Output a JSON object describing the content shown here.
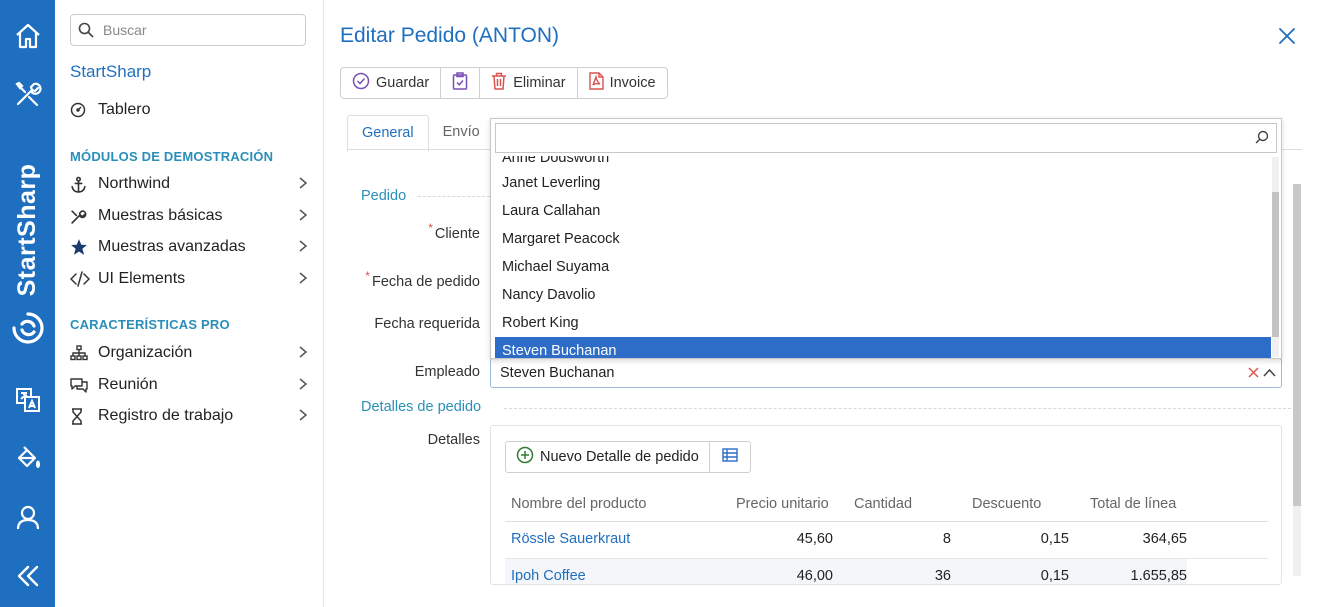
{
  "rail": {
    "brand": "StartSharp",
    "icons": [
      "home-icon",
      "tools-icon",
      "language-icon",
      "theme-icon",
      "user-icon",
      "collapse-icon"
    ]
  },
  "sidebar": {
    "search_placeholder": "Buscar",
    "app_title": "StartSharp",
    "top_item": "Tablero",
    "section_demo": "MÓDULOS DE DEMOSTRACIÓN",
    "demo_items": [
      {
        "label": "Northwind",
        "icon": "anchor-icon"
      },
      {
        "label": "Muestras básicas",
        "icon": "wrench-icon"
      },
      {
        "label": "Muestras avanzadas",
        "icon": "star-icon"
      },
      {
        "label": "UI Elements",
        "icon": "code-icon"
      }
    ],
    "section_pro": "CARACTERÍSTICAS PRO",
    "pro_items": [
      {
        "label": "Organización",
        "icon": "sitemap-icon"
      },
      {
        "label": "Reunión",
        "icon": "chat-icon"
      },
      {
        "label": "Registro de trabajo",
        "icon": "hourglass-icon"
      }
    ]
  },
  "dialog": {
    "title": "Editar Pedido (ANTON)",
    "toolbar": {
      "save": "Guardar",
      "delete": "Eliminar",
      "invoice": "Invoice"
    },
    "tabs": [
      "General",
      "Envío"
    ],
    "category_order": "Pedido",
    "fields": {
      "customer": "Cliente",
      "order_date": "Fecha de pedido",
      "required_date": "Fecha requerida",
      "employee": "Empleado"
    },
    "employee_value": "Steven Buchanan",
    "dropdown": {
      "search_value": "",
      "options": [
        "Anne Dodsworth",
        "Janet Leverling",
        "Laura Callahan",
        "Margaret Peacock",
        "Michael Suyama",
        "Nancy Davolio",
        "Robert King",
        "Steven Buchanan"
      ],
      "selected": "Steven Buchanan"
    },
    "category_details": "Detalles de pedido",
    "details_label": "Detalles",
    "details": {
      "new_button": "Nuevo Detalle de pedido",
      "columns": [
        "Nombre del producto",
        "Precio unitario",
        "Cantidad",
        "Descuento",
        "Total de línea"
      ],
      "rows": [
        {
          "product": "Rössle Sauerkraut",
          "price": "45,60",
          "qty": "8",
          "discount": "0,15",
          "total": "364,65"
        },
        {
          "product": "Ipoh Coffee",
          "price": "46,00",
          "qty": "36",
          "discount": "0,15",
          "total": "1.655,85"
        }
      ]
    }
  }
}
